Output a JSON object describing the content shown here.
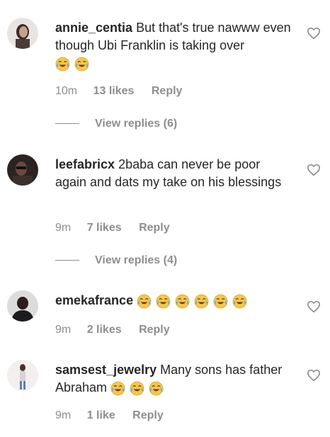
{
  "comments": [
    {
      "username": "annie_centia",
      "text": "But that's true nawww even though Ubi Franklin is taking over",
      "emoji_count": 2,
      "time": "10m",
      "likes": "13 likes",
      "reply": "Reply",
      "view_replies": "View replies (6)"
    },
    {
      "username": "leefabricx",
      "text": "2baba can never be poor again and dats my take on his blessings",
      "emoji_count": 0,
      "time": "9m",
      "likes": "7 likes",
      "reply": "Reply",
      "view_replies": "View replies (4)"
    },
    {
      "username": "emekafrance",
      "text": "",
      "emoji_count": 6,
      "time": "9m",
      "likes": "2 likes",
      "reply": "Reply"
    },
    {
      "username": "samsest_jewelry",
      "text": "Many sons has father Abraham",
      "emoji_count": 3,
      "time": "9m",
      "likes": "1 like",
      "reply": "Reply"
    }
  ],
  "icons": {
    "emoji": "face-with-tears-of-joy-icon",
    "like": "heart-outline-icon"
  },
  "colors": {
    "text": "#262626",
    "muted": "#8e8e8e",
    "heart_stroke": "#8e8e8e"
  }
}
